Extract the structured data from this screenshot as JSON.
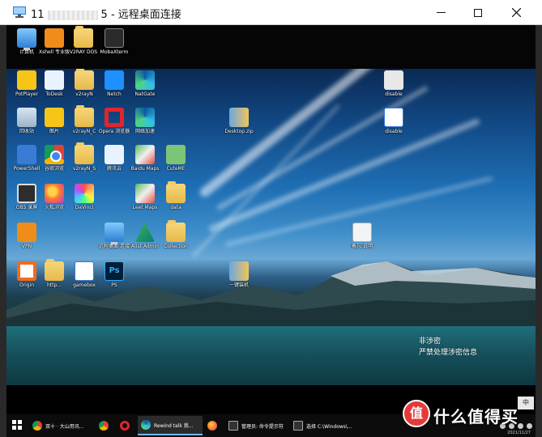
{
  "window": {
    "title_prefix": "11",
    "title_suffix": "5 - 远程桌面连接"
  },
  "top_row_icons": [
    {
      "label": "计算机",
      "icon": "computer-icon"
    },
    {
      "label": "Xshell 专业版",
      "icon": "xshell-icon"
    },
    {
      "label": "V2RAY DOS",
      "icon": "folder-icon"
    },
    {
      "label": "MobaXterm",
      "icon": "mobaxterm-icon"
    }
  ],
  "desktop_icons": [
    {
      "label": "PotPlayer",
      "icon": "potplayer-icon"
    },
    {
      "label": "ToDesk",
      "icon": "cloud-icon"
    },
    {
      "label": "v2rayN",
      "icon": "folder-icon"
    },
    {
      "label": "Netch",
      "icon": "sensor-icon"
    },
    {
      "label": "NatGate",
      "icon": "edge-icon"
    },
    {
      "label": "回收站",
      "icon": "recycle-bin-icon"
    },
    {
      "label": "图片",
      "icon": "potplayer-icon"
    },
    {
      "label": "v2rayN_C",
      "icon": "folder-icon"
    },
    {
      "label": "Opera 浏览器",
      "icon": "opera-icon"
    },
    {
      "label": "网络加速",
      "icon": "edge-icon"
    },
    {
      "label": "Desktop.zip",
      "icon": "zip-icon"
    },
    {
      "label": "PowerShell",
      "icon": "pin-icon"
    },
    {
      "label": "谷歌浏览",
      "icon": "chrome-icon"
    },
    {
      "label": "v2rayN_S",
      "icon": "folder-icon"
    },
    {
      "label": "腾讯云",
      "icon": "cloud-icon"
    },
    {
      "label": "Baidu Maps",
      "icon": "map-icon"
    },
    {
      "label": "CuteME",
      "icon": "cuteme-icon"
    },
    {
      "label": "OBS 录屏",
      "icon": "obs-icon"
    },
    {
      "label": "火狐浏览",
      "icon": "firefox-icon"
    },
    {
      "label": "DaVinci",
      "icon": "flower-icon"
    },
    {
      "label": "Leet Maps",
      "icon": "map-icon"
    },
    {
      "label": "data",
      "icon": "folder-icon"
    },
    {
      "label": "VPN",
      "icon": "vpn-icon"
    },
    {
      "label": "远程桌面 连接",
      "icon": "monitor-icon"
    },
    {
      "label": "Alist Admin",
      "icon": "arrow-icon"
    },
    {
      "label": "Collection",
      "icon": "folder-icon"
    },
    {
      "label": "备忘 说明",
      "icon": "document-icon"
    },
    {
      "label": "Origin",
      "icon": "orange-icon"
    },
    {
      "label": "http...",
      "icon": "folder-icon"
    },
    {
      "label": "gamebox",
      "icon": "window-icon"
    },
    {
      "label": "PS",
      "icon": "photoshop-icon"
    },
    {
      "label": "一键装机",
      "icon": "zip-icon"
    },
    {
      "label": "disable",
      "icon": "gear-icon"
    },
    {
      "label": "disable",
      "icon": "window-icon"
    }
  ],
  "watermark": {
    "line1": "非涉密",
    "line2": "严禁处理涉密信息"
  },
  "ime_indicator": "中",
  "taskbar": {
    "items": [
      {
        "label": "双十 · 大山用讯...",
        "icon": "chrome",
        "active": false
      },
      {
        "label": "",
        "icon": "chrome",
        "active": false
      },
      {
        "label": "",
        "icon": "opera",
        "active": false
      },
      {
        "label": "Rewind talk 我...",
        "icon": "edge",
        "active": true
      },
      {
        "label": "",
        "icon": "firefox",
        "active": false
      },
      {
        "label": "管理员: 命令提示符",
        "icon": "cmd",
        "active": false
      },
      {
        "label": "选择 C:\\Windows\\...",
        "icon": "cmd",
        "active": false
      }
    ],
    "clock": "2021/11/27"
  },
  "logo": {
    "mark": "值",
    "text": "什么值得买"
  },
  "colors": {
    "accent": "#76b9ed",
    "logo_red": "#e63a3a"
  }
}
